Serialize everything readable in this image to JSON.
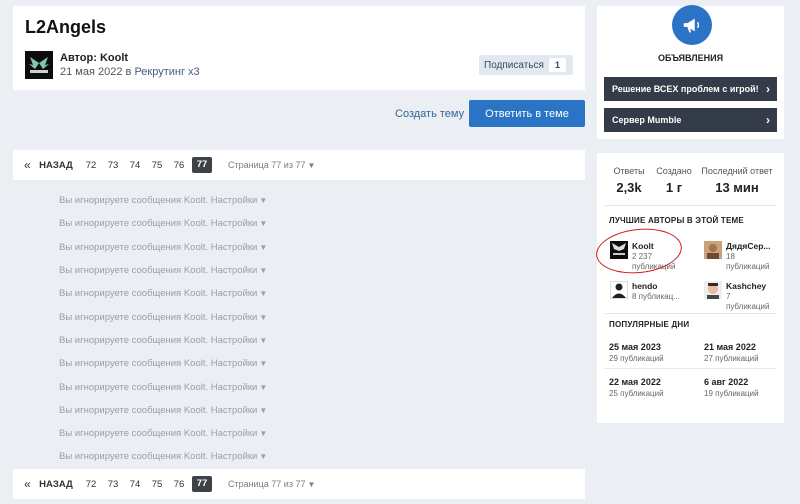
{
  "topic": {
    "title": "L2Angels",
    "author_label": "Автор: Koolt",
    "date": "21 мая 2022",
    "in_word": "в",
    "forum": "Рекрутинг x3",
    "follow_label": "Подписаться",
    "follow_count": "1"
  },
  "actions": {
    "create_topic": "Создать тему",
    "reply": "Ответить в теме"
  },
  "pagination": {
    "first": "«",
    "prev": "НАЗАД",
    "pages": [
      "72",
      "73",
      "74",
      "75",
      "76"
    ],
    "current": "77",
    "jump_label": "Страница 77 из 77"
  },
  "ignored": {
    "text": "Вы игнорируете сообщения Koolt. Настройки",
    "count": 12
  },
  "announcements": {
    "title": "ОБЪЯВЛЕНИЯ",
    "items": [
      {
        "label": "Решение ВСЕХ проблем с игрой!"
      },
      {
        "label": "Сервер Mumble"
      }
    ]
  },
  "stats": {
    "replies_label": "Ответы",
    "replies_value": "2,3k",
    "created_label": "Создано",
    "created_value": "1 г",
    "last_label": "Последний ответ",
    "last_value": "13 мин"
  },
  "best_authors": {
    "title": "ЛУЧШИЕ АВТОРЫ В ЭТОЙ ТЕМЕ",
    "items": [
      {
        "name": "Koolt",
        "count": "2 237 публикаций"
      },
      {
        "name": "ДядяСер...",
        "count": "18 публикаций"
      },
      {
        "name": "hendo",
        "count": "8 публикац..."
      },
      {
        "name": "Kashchey",
        "count": "7 публикаций"
      }
    ]
  },
  "popular_days": {
    "title": "ПОПУЛЯРНЫЕ ДНИ",
    "items": [
      {
        "date": "25 мая 2023",
        "count": "29 публикаций"
      },
      {
        "date": "21 мая 2022",
        "count": "27 публикаций"
      },
      {
        "date": "22 мая 2022",
        "count": "25 публикаций"
      },
      {
        "date": "6 авг 2022",
        "count": "19 публикаций"
      }
    ]
  },
  "colors": {
    "accent": "#2b74c5",
    "announcement_bg": "#343c49",
    "annotation_circle": "#d01b1b"
  }
}
